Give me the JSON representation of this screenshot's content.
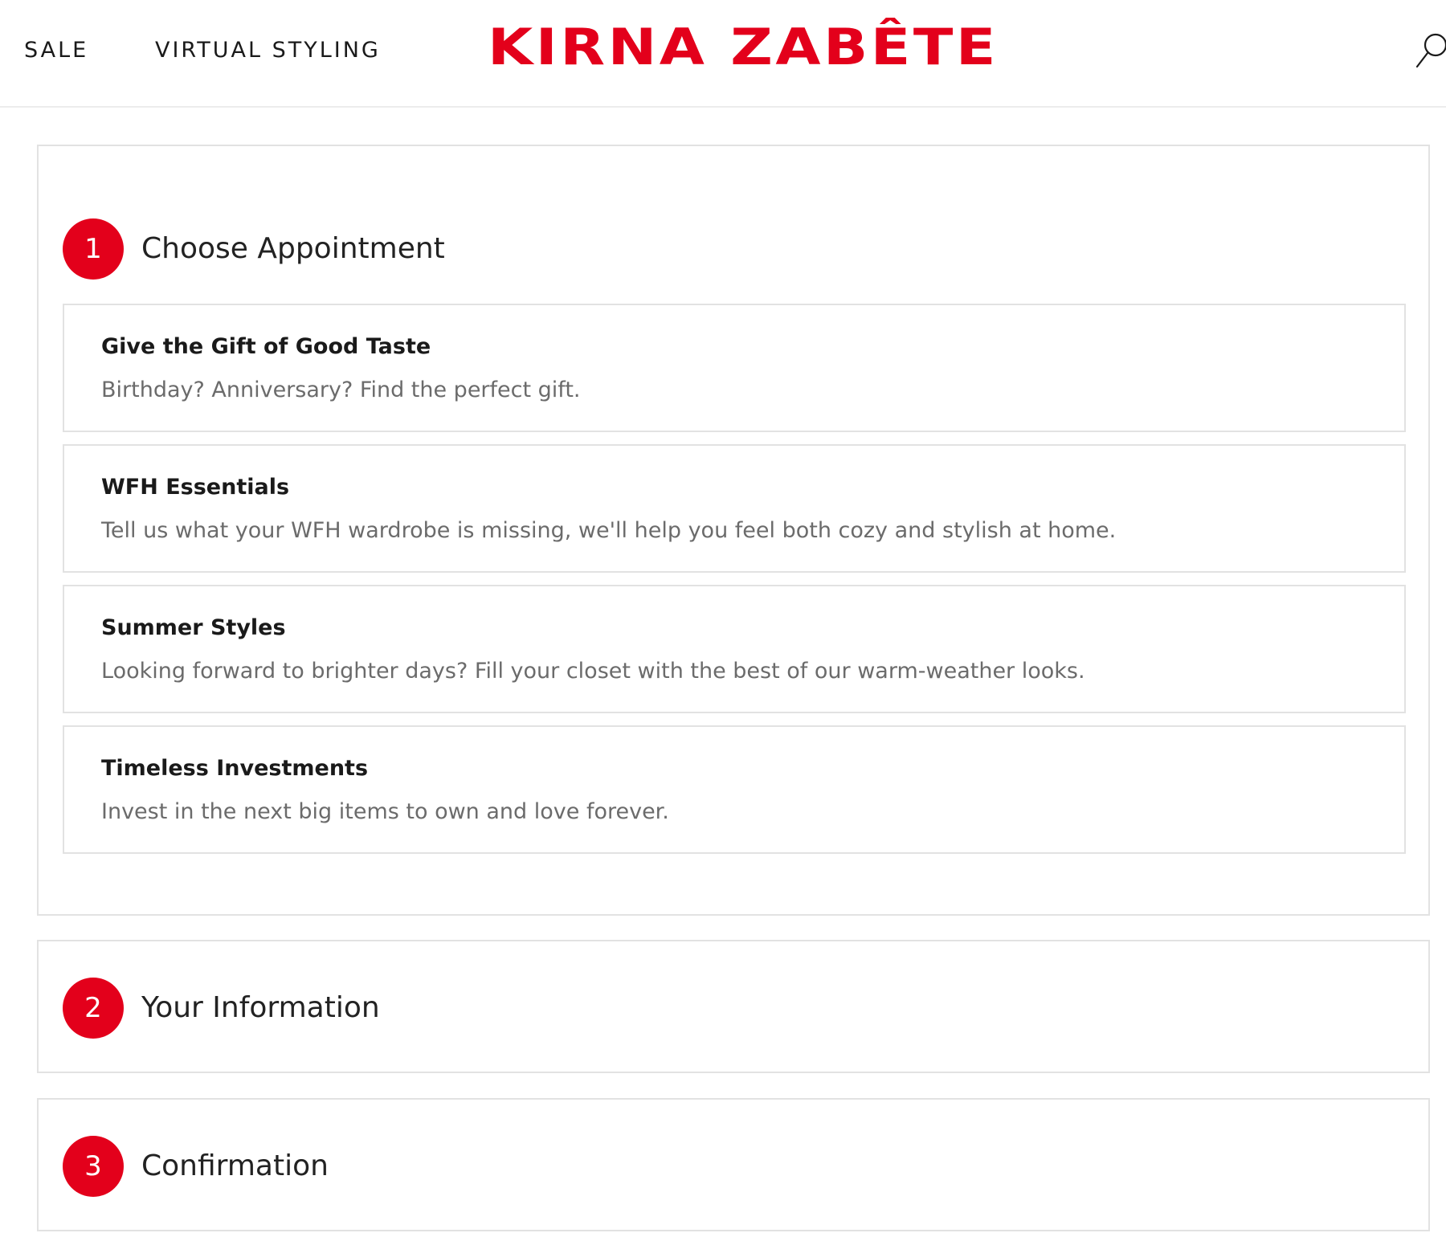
{
  "header": {
    "nav": [
      {
        "label": "SALE"
      },
      {
        "label": "VIRTUAL STYLING"
      }
    ],
    "logo_text": "KIRNA ZABÊTE",
    "search_icon": "search-icon",
    "brand_color": "#e3001b"
  },
  "steps": [
    {
      "number": "1",
      "title": "Choose Appointment",
      "options": [
        {
          "title": "Give the Gift of Good Taste",
          "description": "Birthday? Anniversary? Find the perfect gift."
        },
        {
          "title": "WFH Essentials",
          "description": "Tell us what your WFH wardrobe is missing, we'll help you feel both cozy and stylish at home."
        },
        {
          "title": "Summer Styles",
          "description": "Looking forward to brighter days? Fill your closet with the best of our warm-weather looks."
        },
        {
          "title": "Timeless Investments",
          "description": "Invest in the next big items to own and love forever."
        }
      ]
    },
    {
      "number": "2",
      "title": "Your Information"
    },
    {
      "number": "3",
      "title": "Confirmation"
    }
  ]
}
